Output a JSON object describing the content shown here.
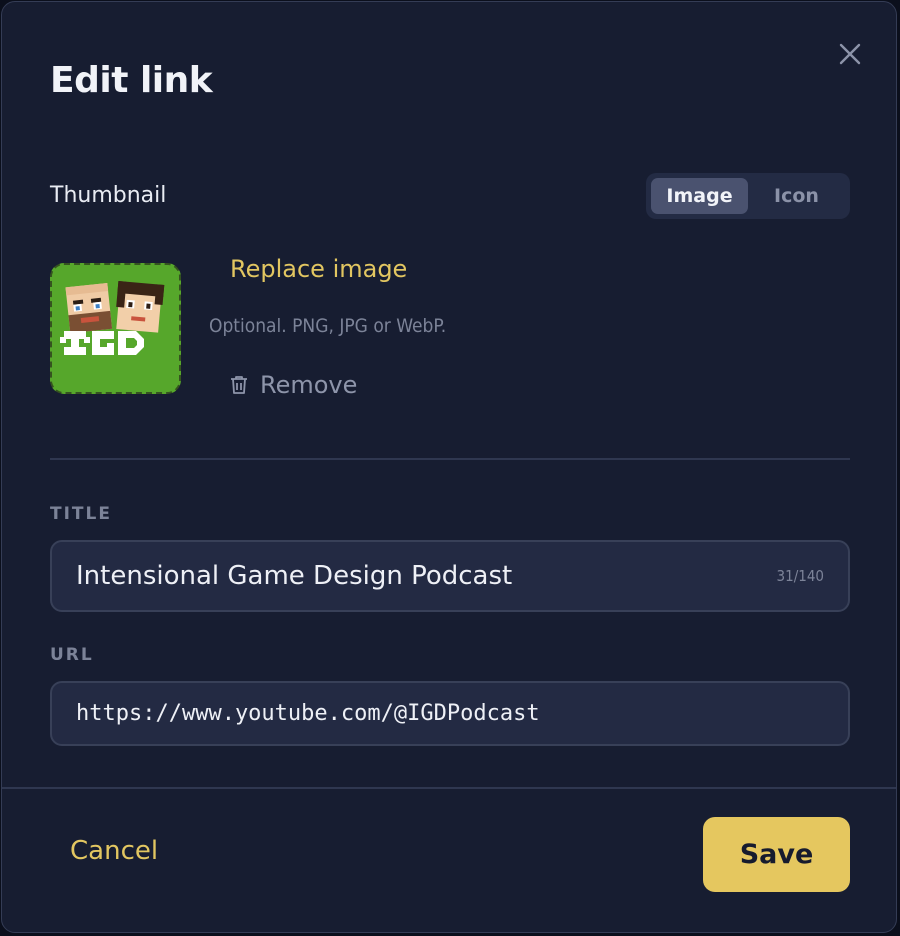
{
  "dialog": {
    "title": "Edit link",
    "close_icon": "close-icon"
  },
  "thumbnail": {
    "label": "Thumbnail",
    "segments": [
      {
        "label": "Image",
        "active": true
      },
      {
        "label": "Icon",
        "active": false
      }
    ],
    "image_alt": "IGD",
    "replace_label": "Replace image",
    "hint": "Optional. PNG, JPG or WebP.",
    "remove_label": "Remove",
    "remove_icon": "trash-icon"
  },
  "title_field": {
    "label": "TITLE",
    "value": "Intensional Game Design Podcast",
    "counter": "31/140"
  },
  "url_field": {
    "label": "URL",
    "value": "https://www.youtube.com/@IGDPodcast"
  },
  "footer": {
    "cancel_label": "Cancel",
    "save_label": "Save"
  },
  "colors": {
    "background": "#171d31",
    "accent": "#e5c75f",
    "field_bg": "#232a43",
    "muted_text": "#7c8398"
  }
}
